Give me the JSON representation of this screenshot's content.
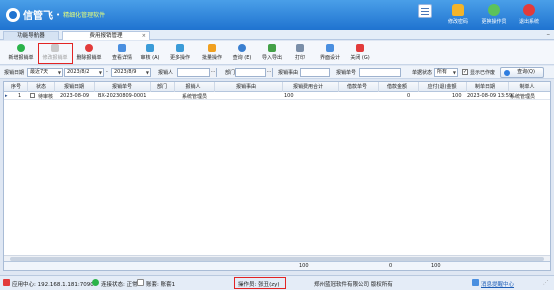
{
  "header": {
    "brand": "信管飞",
    "subtitle": "精细化管理软件",
    "buttons": [
      {
        "label": "",
        "icon": "list-icon"
      },
      {
        "label": "修改密码",
        "icon": "lock-icon"
      },
      {
        "label": "更换操作员",
        "icon": "user-switch-icon"
      },
      {
        "label": "退出系统",
        "icon": "exit-icon"
      }
    ]
  },
  "tabs": [
    {
      "label": "功能导航器"
    },
    {
      "label": "费用报销管理"
    }
  ],
  "toolbar": {
    "items": [
      {
        "label": "新增报销单",
        "color": "#2bb34a"
      },
      {
        "label": "修改报销单",
        "color": "#c8c8c8"
      },
      {
        "label": "删除报销单",
        "color": "#e23b3b"
      },
      {
        "label": "查看详情",
        "color": "#4a8fe0"
      },
      {
        "label": "审核 (A)",
        "color": "#3a9bd8"
      },
      {
        "label": "更多操作",
        "color": "#3a9bd8"
      },
      {
        "label": "批量操作",
        "color": "#f0a020"
      },
      {
        "label": "查询 (E)",
        "color": "#3a7fd0"
      },
      {
        "label": "导入导出",
        "color": "#43a047"
      },
      {
        "label": "打印",
        "color": "#7a8ea8"
      },
      {
        "label": "界面设计",
        "color": "#4a8fe0"
      },
      {
        "label": "关闭 (G)",
        "color": "#e23b3b"
      }
    ]
  },
  "filter": {
    "date_label": "报销日期",
    "date_range": "最近7天",
    "date_from": "2023/8/2",
    "date_to": "2023/8/9",
    "reimburser_label": "报销人",
    "dept_label": "部门",
    "reason_label": "报销事由",
    "number_label": "报销单号",
    "status_label": "单据状态",
    "status_value": "所有",
    "show_stopped_label": "显示已作废",
    "query_label": "查询(Q)"
  },
  "table": {
    "columns": [
      "序号",
      "状态",
      "报销日期",
      "报销单号",
      "部门",
      "报销人",
      "报销事由",
      "报销费用合计",
      "借款单号",
      "借款金额",
      "应付(退)金额",
      "制单日期",
      "制单人"
    ],
    "rows": [
      [
        "1",
        "待审核",
        "2023-08-09",
        "BX-20230809-0001",
        "",
        "系统管理员",
        "",
        "100",
        "",
        "0",
        "100",
        "2023-08-09 13:59",
        "系统管理员"
      ]
    ],
    "totals": {
      "expense_total": "100",
      "loan_amount": "0",
      "payable": "100"
    }
  },
  "status": {
    "app_center": "应用中心: 192.168.1.181:7090",
    "connection": "连接状态: 正常",
    "account": "账套: 账套1",
    "operator": "操作员: 张丑(zy)",
    "company": "郑州蓝冠软件有限公司  版权所有",
    "message_center": "消息提醒中心"
  },
  "colors": {
    "header_top": "#4a9fe8",
    "header_bottom": "#1f73d0",
    "highlight_red": "#e22424"
  }
}
